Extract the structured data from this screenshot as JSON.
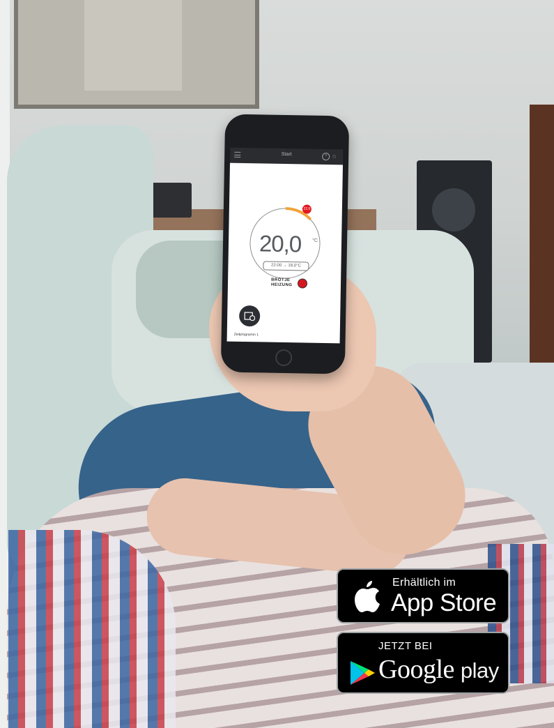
{
  "phone": {
    "screen_title": "Start",
    "temperature": "20,0",
    "temperature_unit": "°C",
    "schedule_text": "22:00 → 18,0°C",
    "setpoint_badge": "22,0",
    "logo_text_top": "BRÖTJE",
    "logo_text_bottom": "HEIZUNG",
    "program_label": "Zeitprogramm 1"
  },
  "badges": {
    "app_store": {
      "small_text": "Erhältlich im",
      "big_text": "App Store"
    },
    "google_play": {
      "small_text": "JETZT BEI",
      "big_text_google": "Google",
      "big_text_play": "play"
    }
  },
  "colors": {
    "dial_accent": "#f2a33a",
    "badge_red": "#e2191f",
    "store_bg": "#000000"
  }
}
